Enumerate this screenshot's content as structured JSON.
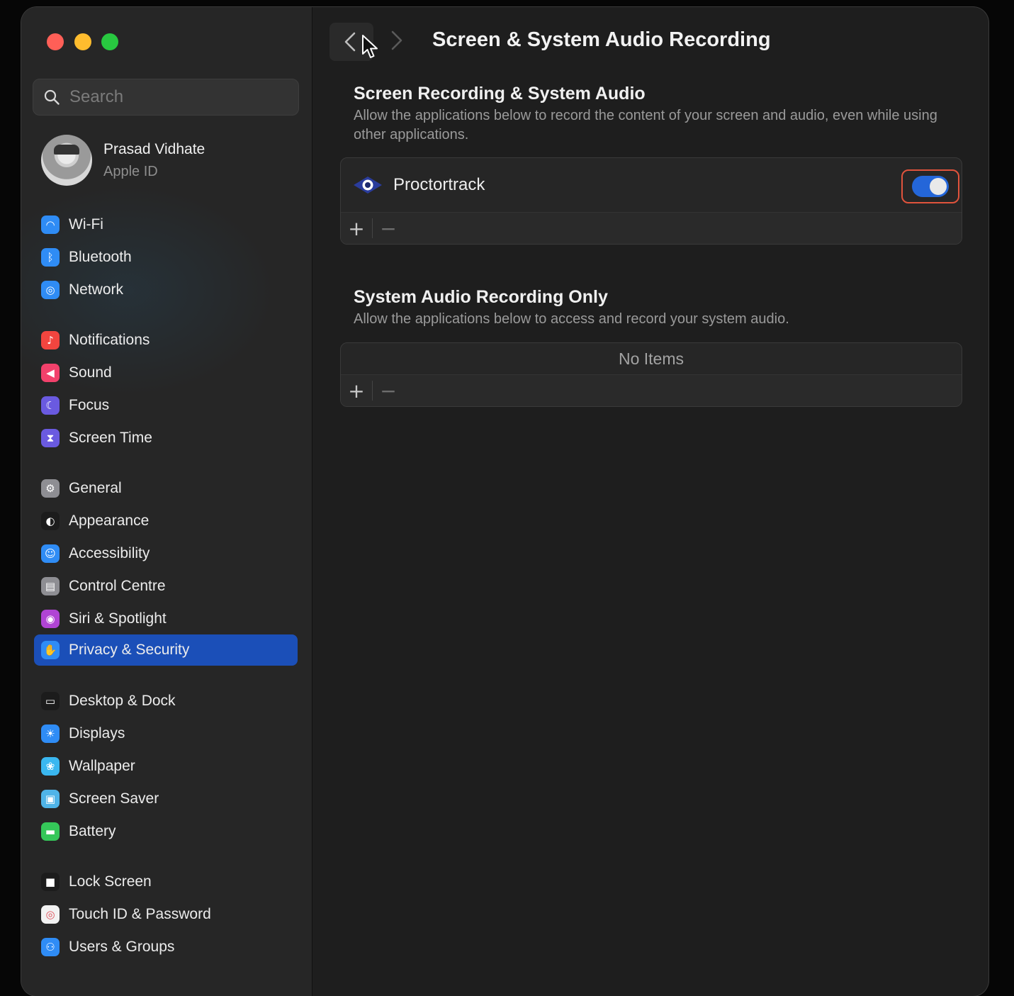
{
  "window": {
    "title": "Screen & System Audio Recording"
  },
  "search": {
    "placeholder": "Search"
  },
  "profile": {
    "name": "Prasad Vidhate",
    "subtitle": "Apple ID"
  },
  "sidebar": {
    "items": [
      {
        "label": "Wi-Fi",
        "icon": "wifi-icon",
        "color": "#2f8cf5"
      },
      {
        "label": "Bluetooth",
        "icon": "bluetooth-icon",
        "color": "#2f8cf5"
      },
      {
        "label": "Network",
        "icon": "globe-icon",
        "color": "#2f8cf5"
      },
      {
        "label": "Notifications",
        "icon": "bell-icon",
        "color": "#f2453f"
      },
      {
        "label": "Sound",
        "icon": "speaker-icon",
        "color": "#f2416b"
      },
      {
        "label": "Focus",
        "icon": "moon-icon",
        "color": "#6a5ae0"
      },
      {
        "label": "Screen Time",
        "icon": "hourglass-icon",
        "color": "#6a5ae0"
      },
      {
        "label": "General",
        "icon": "gear-icon",
        "color": "#8e8e93"
      },
      {
        "label": "Appearance",
        "icon": "appearance-icon",
        "color": "#1c1c1c"
      },
      {
        "label": "Accessibility",
        "icon": "accessibility-icon",
        "color": "#2f8cf5"
      },
      {
        "label": "Control Centre",
        "icon": "control-centre-icon",
        "color": "#8e8e93"
      },
      {
        "label": "Siri & Spotlight",
        "icon": "siri-icon",
        "color": "#b044d4"
      },
      {
        "label": "Privacy & Security",
        "icon": "hand-icon",
        "color": "#2f8cf5",
        "active": true
      },
      {
        "label": "Desktop & Dock",
        "icon": "dock-icon",
        "color": "#1c1c1c"
      },
      {
        "label": "Displays",
        "icon": "sun-icon",
        "color": "#2f8cf5"
      },
      {
        "label": "Wallpaper",
        "icon": "wallpaper-icon",
        "color": "#3ab7f0"
      },
      {
        "label": "Screen Saver",
        "icon": "screen-saver-icon",
        "color": "#4fb4e8"
      },
      {
        "label": "Battery",
        "icon": "battery-icon",
        "color": "#35c759"
      },
      {
        "label": "Lock Screen",
        "icon": "lock-icon",
        "color": "#1c1c1c"
      },
      {
        "label": "Touch ID & Password",
        "icon": "fingerprint-icon",
        "color": "#f2f2f2"
      },
      {
        "label": "Users & Groups",
        "icon": "users-icon",
        "color": "#2f8cf5"
      }
    ]
  },
  "main": {
    "page_title": "Screen & System Audio Recording",
    "section1": {
      "title": "Screen Recording & System Audio",
      "description": "Allow the applications below to record the content of your screen and audio, even while using other applications.",
      "apps": [
        {
          "name": "Proctortrack",
          "enabled": true
        }
      ]
    },
    "section2": {
      "title": "System Audio Recording Only",
      "description": "Allow the applications below to access and record your system audio.",
      "empty_text": "No Items"
    },
    "toolbar": {
      "add_label": "+",
      "remove_label": "−"
    }
  }
}
